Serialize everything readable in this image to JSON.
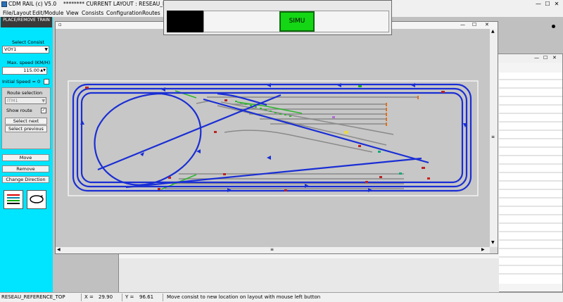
{
  "titlebar": {
    "title": "CDM RAIL (c) V5.0",
    "current_layout": "******** CURRENT LAYOUT : RESEAU_REFERENCE",
    "minimize": "—",
    "maximize": "☐",
    "close": "✕"
  },
  "menu": [
    "File/Layout",
    "Edit/Module",
    "View",
    "Consists",
    "Configuration",
    "Routes"
  ],
  "left_panel": {
    "header": "PLACE/REMOVE TRAIN",
    "select_consist_label": "Select Consist",
    "consist_value": "VOY1",
    "max_speed_label": "Max. speed (KM/H)",
    "max_speed_value": "115.00",
    "initial_speed_label": "Initial Speed = 0",
    "route_selection_label": "Route selection",
    "route_value": "ITM1",
    "show_route_label": "Show route",
    "select_next": "Select next",
    "select_previous": "Select previous",
    "move": "Move",
    "remove": "Remove",
    "change_direction": "Change Direction"
  },
  "simu": {
    "button": "SIMU"
  },
  "statusbar": {
    "layout_name": "RESEAU_REFERENCE_TOP",
    "x_label": "X =",
    "x_value": "29.90",
    "y_label": "Y =",
    "y_value": "96.61",
    "message": "Move consist to new location on layout with mouse left button"
  },
  "colors": {
    "panel_bg": "#00e5ff",
    "track_main": "#1a2ed4",
    "track_siding": "#8a8a8a",
    "simu_green": "#14d614"
  },
  "icons": [
    "app-icon",
    "minimize-icon",
    "maximize-icon",
    "close-icon",
    "dropdown-arrow-icon",
    "spinner-icon",
    "checkbox-icon",
    "track-color-icon",
    "loop-route-icon"
  ]
}
